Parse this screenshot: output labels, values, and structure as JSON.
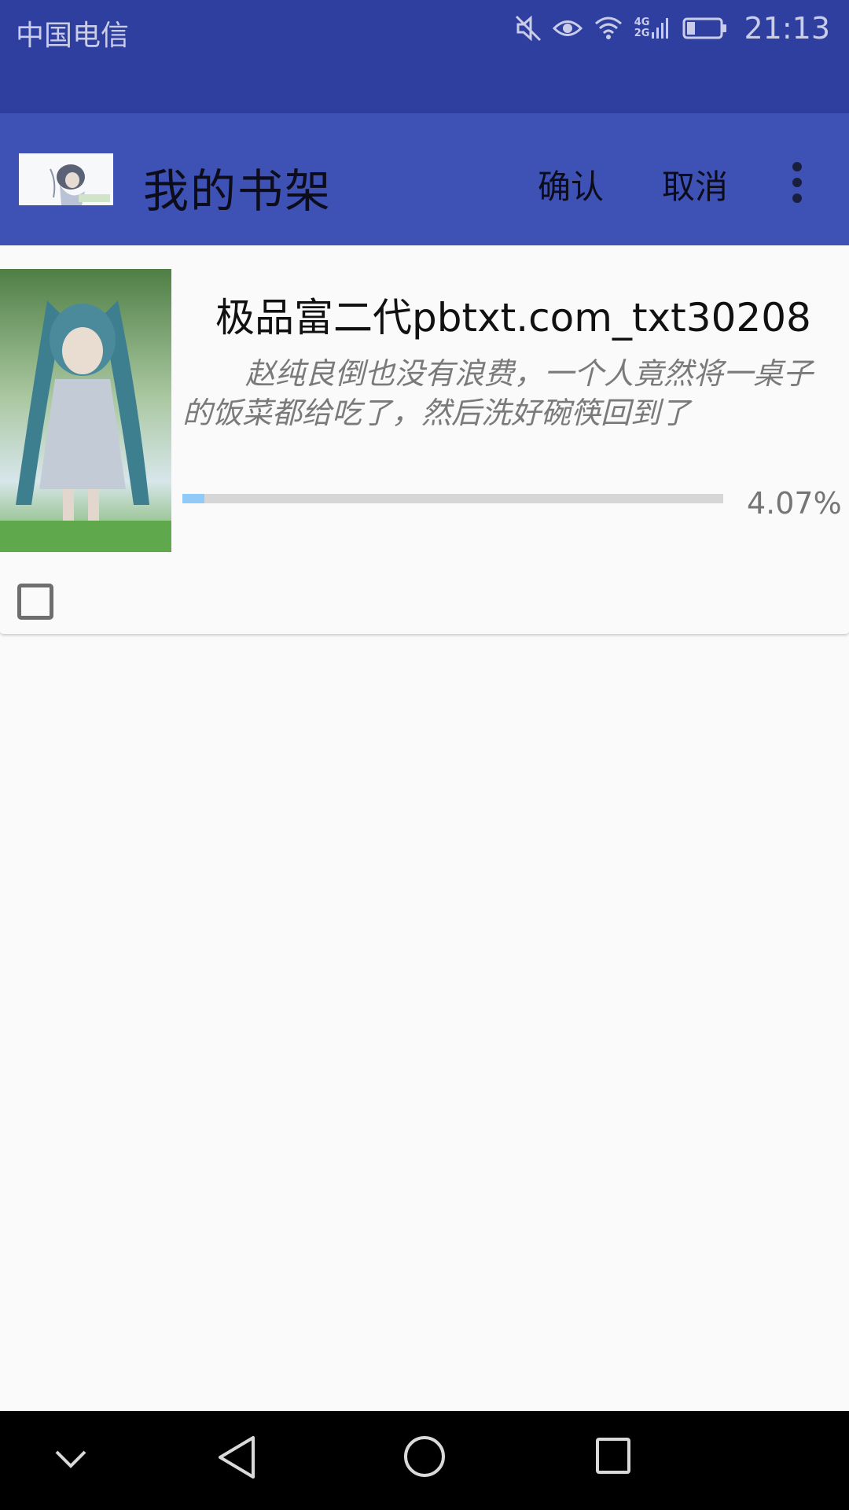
{
  "status_bar": {
    "carrier": "中国电信",
    "network_label_top": "4G",
    "network_label_bottom": "2G",
    "time": "21:13",
    "icons": [
      "mute-icon",
      "eye-comfort-icon",
      "wifi-icon",
      "signal-icon",
      "battery-icon"
    ]
  },
  "app_bar": {
    "title": "我的书架",
    "confirm_label": "确认",
    "cancel_label": "取消",
    "menu_icon": "more-vert-icon",
    "color": "#3e51b5"
  },
  "books": [
    {
      "title": "极品富二代pbtxt.com_txt30208",
      "excerpt": "赵纯良倒也没有浪费，一个人竟然将一桌子的饭菜都给吃了，然后洗好碗筷回到了",
      "progress": 0.0407,
      "progress_text": "4.07%",
      "checked": false
    }
  ],
  "nav_bar": {
    "icons": [
      "chevron-down-icon",
      "back-icon",
      "home-icon",
      "recents-icon"
    ]
  },
  "colors": {
    "status_bar": "#2f3f9f",
    "progress_fill": "#90caf9",
    "progress_track": "#d6d6d6"
  }
}
